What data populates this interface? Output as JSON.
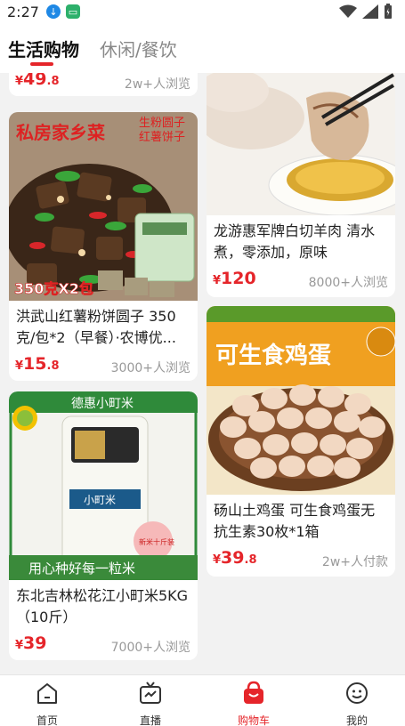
{
  "status_bar": {
    "time": "2:27"
  },
  "tabs": [
    {
      "label": "生活购物",
      "active": true
    },
    {
      "label": "休闲/餐饮",
      "active": false
    }
  ],
  "feed": {
    "left": [
      {
        "title": "",
        "price": {
          "currency": "¥",
          "int": "49",
          "dec": ".8"
        },
        "views": "2w+人浏览"
      },
      {
        "title": "洪武山红薯粉饼圆子 350克/包*2（早餐）·农博优...",
        "price": {
          "currency": "¥",
          "int": "15",
          "dec": ".8"
        },
        "views": "3000+人浏览",
        "image_text": {
          "brand": "私房家乡菜",
          "sub1": "生粉圆子",
          "sub2": "红薯饼子",
          "weight": "350克X2包"
        }
      },
      {
        "title": "东北吉林松花江小町米5KG（10斤）",
        "price": {
          "currency": "¥",
          "int": "39",
          "dec": ""
        },
        "views": "7000+人浏览",
        "image_text": {
          "brand": "德惠小町米",
          "bag": "小町米",
          "badge": "新米十斤装",
          "slogan": "用心种好每一粒米"
        }
      }
    ],
    "right": [
      {
        "title": "龙游惠军牌白切羊肉 清水煮，零添加，原味",
        "price": {
          "currency": "¥",
          "int": "120",
          "dec": ""
        },
        "views": "8000+人浏览"
      },
      {
        "title": "砀山土鸡蛋 可生食鸡蛋无抗生素30枚*1箱",
        "price": {
          "currency": "¥",
          "int": "39",
          "dec": ".8"
        },
        "views": "2w+人付款",
        "image_text": {
          "box": "可生食鸡蛋"
        }
      }
    ]
  },
  "nav": [
    {
      "label": "首页",
      "icon": "home-icon",
      "active": false
    },
    {
      "label": "直播",
      "icon": "tv-icon",
      "active": false
    },
    {
      "label": "购物车",
      "icon": "cart-icon",
      "active": true
    },
    {
      "label": "我的",
      "icon": "profile-icon",
      "active": false
    }
  ],
  "colors": {
    "accent": "#e5252a",
    "background": "#f2f2f2"
  }
}
